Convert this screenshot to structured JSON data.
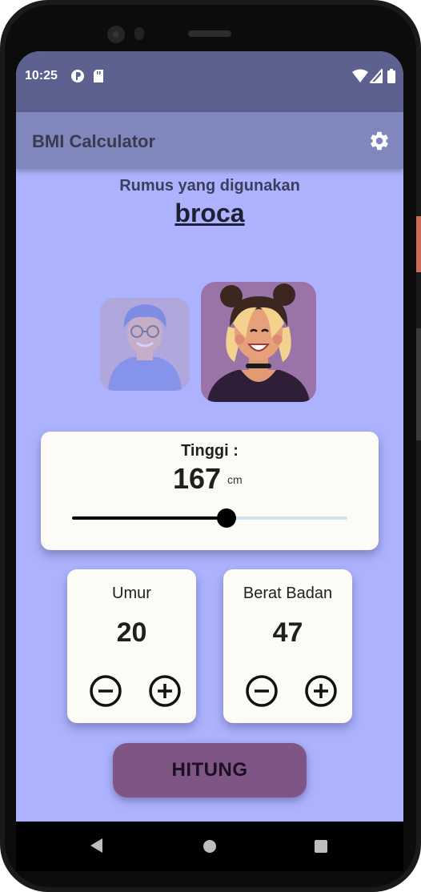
{
  "status_bar": {
    "time": "10:25"
  },
  "app_bar": {
    "title": "BMI Calculator"
  },
  "formula": {
    "label": "Rumus yang digunakan",
    "value": "broca"
  },
  "gender": {
    "selected": "female"
  },
  "height": {
    "label": "Tinggi :",
    "value": "167",
    "unit": "cm",
    "slider_fraction": 0.56
  },
  "age": {
    "label": "Umur",
    "value": "20"
  },
  "weight": {
    "label": "Berat Badan",
    "value": "47"
  },
  "action": {
    "button_label": "HITUNG"
  },
  "colors": {
    "background": "#acb2fd",
    "app_bar": "#8087bc",
    "status_bar": "#5c6190",
    "card": "#fdfbf5",
    "button": "#7f5585"
  }
}
